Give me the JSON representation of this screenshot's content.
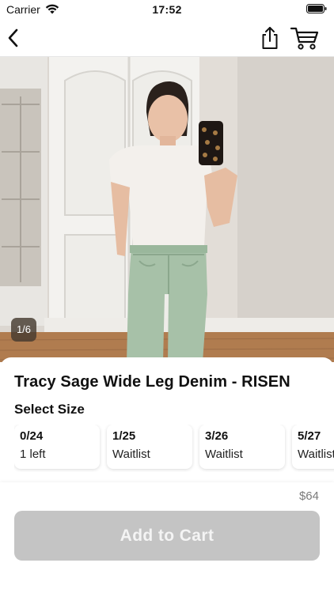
{
  "status_bar": {
    "carrier": "Carrier",
    "time": "17:52"
  },
  "nav": {
    "back_icon": "chevron-left-icon",
    "share_icon": "share-icon",
    "cart_icon": "shopping-cart-icon"
  },
  "gallery": {
    "counter": "1/6"
  },
  "product": {
    "title": "Tracy Sage Wide Leg Denim - RISEN",
    "select_size_label": "Select Size",
    "sizes": [
      {
        "name": "0/24",
        "status": "1 left"
      },
      {
        "name": "1/25",
        "status": "Waitlist"
      },
      {
        "name": "3/26",
        "status": "Waitlist"
      },
      {
        "name": "5/27",
        "status": "Waitlist"
      }
    ],
    "price": "$64"
  },
  "footer": {
    "add_to_cart_label": "Add to Cart",
    "button_color": "#c4c4c4"
  }
}
